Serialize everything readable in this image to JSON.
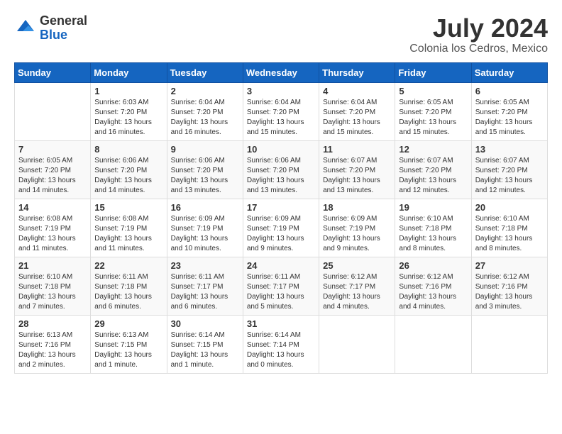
{
  "header": {
    "logo_general": "General",
    "logo_blue": "Blue",
    "month_title": "July 2024",
    "location": "Colonia los Cedros, Mexico"
  },
  "days_of_week": [
    "Sunday",
    "Monday",
    "Tuesday",
    "Wednesday",
    "Thursday",
    "Friday",
    "Saturday"
  ],
  "weeks": [
    [
      {
        "day": "",
        "info": ""
      },
      {
        "day": "1",
        "info": "Sunrise: 6:03 AM\nSunset: 7:20 PM\nDaylight: 13 hours\nand 16 minutes."
      },
      {
        "day": "2",
        "info": "Sunrise: 6:04 AM\nSunset: 7:20 PM\nDaylight: 13 hours\nand 16 minutes."
      },
      {
        "day": "3",
        "info": "Sunrise: 6:04 AM\nSunset: 7:20 PM\nDaylight: 13 hours\nand 15 minutes."
      },
      {
        "day": "4",
        "info": "Sunrise: 6:04 AM\nSunset: 7:20 PM\nDaylight: 13 hours\nand 15 minutes."
      },
      {
        "day": "5",
        "info": "Sunrise: 6:05 AM\nSunset: 7:20 PM\nDaylight: 13 hours\nand 15 minutes."
      },
      {
        "day": "6",
        "info": "Sunrise: 6:05 AM\nSunset: 7:20 PM\nDaylight: 13 hours\nand 15 minutes."
      }
    ],
    [
      {
        "day": "7",
        "info": "Sunrise: 6:05 AM\nSunset: 7:20 PM\nDaylight: 13 hours\nand 14 minutes."
      },
      {
        "day": "8",
        "info": "Sunrise: 6:06 AM\nSunset: 7:20 PM\nDaylight: 13 hours\nand 14 minutes."
      },
      {
        "day": "9",
        "info": "Sunrise: 6:06 AM\nSunset: 7:20 PM\nDaylight: 13 hours\nand 13 minutes."
      },
      {
        "day": "10",
        "info": "Sunrise: 6:06 AM\nSunset: 7:20 PM\nDaylight: 13 hours\nand 13 minutes."
      },
      {
        "day": "11",
        "info": "Sunrise: 6:07 AM\nSunset: 7:20 PM\nDaylight: 13 hours\nand 13 minutes."
      },
      {
        "day": "12",
        "info": "Sunrise: 6:07 AM\nSunset: 7:20 PM\nDaylight: 13 hours\nand 12 minutes."
      },
      {
        "day": "13",
        "info": "Sunrise: 6:07 AM\nSunset: 7:20 PM\nDaylight: 13 hours\nand 12 minutes."
      }
    ],
    [
      {
        "day": "14",
        "info": "Sunrise: 6:08 AM\nSunset: 7:19 PM\nDaylight: 13 hours\nand 11 minutes."
      },
      {
        "day": "15",
        "info": "Sunrise: 6:08 AM\nSunset: 7:19 PM\nDaylight: 13 hours\nand 11 minutes."
      },
      {
        "day": "16",
        "info": "Sunrise: 6:09 AM\nSunset: 7:19 PM\nDaylight: 13 hours\nand 10 minutes."
      },
      {
        "day": "17",
        "info": "Sunrise: 6:09 AM\nSunset: 7:19 PM\nDaylight: 13 hours\nand 9 minutes."
      },
      {
        "day": "18",
        "info": "Sunrise: 6:09 AM\nSunset: 7:19 PM\nDaylight: 13 hours\nand 9 minutes."
      },
      {
        "day": "19",
        "info": "Sunrise: 6:10 AM\nSunset: 7:18 PM\nDaylight: 13 hours\nand 8 minutes."
      },
      {
        "day": "20",
        "info": "Sunrise: 6:10 AM\nSunset: 7:18 PM\nDaylight: 13 hours\nand 8 minutes."
      }
    ],
    [
      {
        "day": "21",
        "info": "Sunrise: 6:10 AM\nSunset: 7:18 PM\nDaylight: 13 hours\nand 7 minutes."
      },
      {
        "day": "22",
        "info": "Sunrise: 6:11 AM\nSunset: 7:18 PM\nDaylight: 13 hours\nand 6 minutes."
      },
      {
        "day": "23",
        "info": "Sunrise: 6:11 AM\nSunset: 7:17 PM\nDaylight: 13 hours\nand 6 minutes."
      },
      {
        "day": "24",
        "info": "Sunrise: 6:11 AM\nSunset: 7:17 PM\nDaylight: 13 hours\nand 5 minutes."
      },
      {
        "day": "25",
        "info": "Sunrise: 6:12 AM\nSunset: 7:17 PM\nDaylight: 13 hours\nand 4 minutes."
      },
      {
        "day": "26",
        "info": "Sunrise: 6:12 AM\nSunset: 7:16 PM\nDaylight: 13 hours\nand 4 minutes."
      },
      {
        "day": "27",
        "info": "Sunrise: 6:12 AM\nSunset: 7:16 PM\nDaylight: 13 hours\nand 3 minutes."
      }
    ],
    [
      {
        "day": "28",
        "info": "Sunrise: 6:13 AM\nSunset: 7:16 PM\nDaylight: 13 hours\nand 2 minutes."
      },
      {
        "day": "29",
        "info": "Sunrise: 6:13 AM\nSunset: 7:15 PM\nDaylight: 13 hours\nand 1 minute."
      },
      {
        "day": "30",
        "info": "Sunrise: 6:14 AM\nSunset: 7:15 PM\nDaylight: 13 hours\nand 1 minute."
      },
      {
        "day": "31",
        "info": "Sunrise: 6:14 AM\nSunset: 7:14 PM\nDaylight: 13 hours\nand 0 minutes."
      },
      {
        "day": "",
        "info": ""
      },
      {
        "day": "",
        "info": ""
      },
      {
        "day": "",
        "info": ""
      }
    ]
  ]
}
